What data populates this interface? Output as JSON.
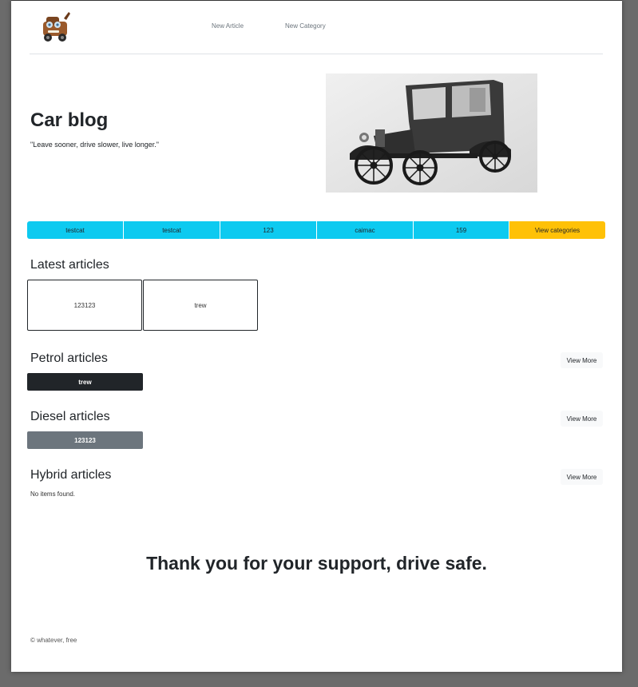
{
  "nav": {
    "logo_icon": "tow-truck-mater-icon",
    "links": [
      "New Article",
      "New Category"
    ]
  },
  "hero": {
    "title": "Car blog",
    "quote": "\"Leave sooner, drive slower, live longer.\"",
    "image_icon": "vintage-car-photo"
  },
  "categories": {
    "items": [
      "testcat",
      "testcat",
      "123",
      "caimac",
      "159"
    ],
    "view_label": "View categories",
    "colors": {
      "category": "#0dcaf0",
      "view": "#ffc107"
    }
  },
  "latest": {
    "title": "Latest articles",
    "cards": [
      "123123",
      "trew"
    ]
  },
  "petrol": {
    "title": "Petrol articles",
    "view_more": "View More",
    "articles": [
      "trew"
    ],
    "color": "#212529"
  },
  "diesel": {
    "title": "Diesel articles",
    "view_more": "View More",
    "articles": [
      "123123"
    ],
    "color": "#6c757d"
  },
  "hybrid": {
    "title": "Hybrid articles",
    "view_more": "View More",
    "empty": "No items found."
  },
  "thanks": "Thank you for your support, drive safe.",
  "footer": "© whatever, free"
}
